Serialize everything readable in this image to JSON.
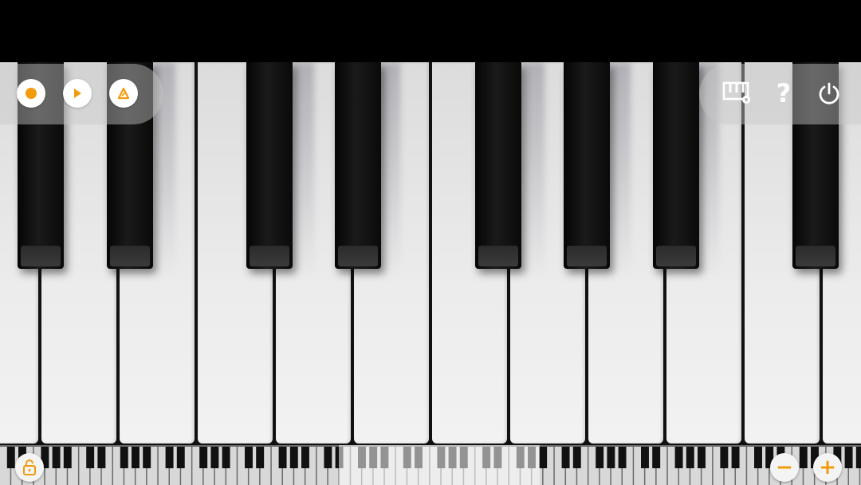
{
  "app": {
    "accent_color": "#f29b0c",
    "key_white_color": "#ececec",
    "key_black_color": "#0a0a0a"
  },
  "toolbar_left": {
    "record_icon": "record-icon",
    "play_icon": "play-icon",
    "metronome_icon": "metronome-icon"
  },
  "toolbar_right": {
    "keyboard_settings_icon": "keyboard-settings-icon",
    "help_label": "?",
    "power_icon": "power-icon"
  },
  "bottom_bar": {
    "lock_icon": "lock-icon",
    "zoom_out_label": "−",
    "zoom_in_label": "+"
  }
}
